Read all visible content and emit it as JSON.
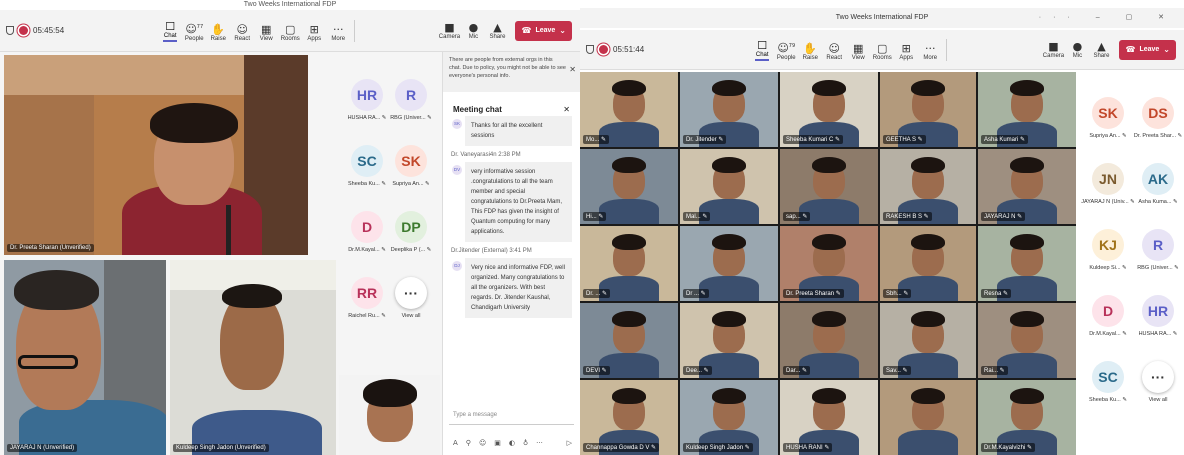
{
  "left": {
    "title": "Two Weeks International FDP",
    "timer": "05:45:54",
    "tools": [
      {
        "icon": "chat-icon",
        "glyph": "☐",
        "label": "Chat",
        "active": true
      },
      {
        "icon": "people-icon",
        "glyph": "☺",
        "label": "People",
        "badge": "77"
      },
      {
        "icon": "raise-hand-icon",
        "glyph": "✋",
        "label": "Raise"
      },
      {
        "icon": "react-icon",
        "glyph": "☺",
        "label": "React"
      },
      {
        "icon": "view-icon",
        "glyph": "▦",
        "label": "View"
      },
      {
        "icon": "rooms-icon",
        "glyph": "▢",
        "label": "Rooms"
      },
      {
        "icon": "apps-icon",
        "glyph": "⊞",
        "label": "Apps"
      },
      {
        "icon": "more-icon",
        "glyph": "···",
        "label": "More"
      }
    ],
    "devices": [
      {
        "icon": "camera-icon",
        "glyph": "■",
        "label": "Camera"
      },
      {
        "icon": "mic-icon",
        "glyph": "●",
        "label": "Mic"
      },
      {
        "icon": "share-icon",
        "glyph": "▲",
        "label": "Share"
      }
    ],
    "leave": "Leave",
    "speaker": "Dr. Preeta Sharan (Unverified)",
    "tiles": [
      {
        "name": "JAYARAJ N (Unverified)"
      },
      {
        "name": "Kuldeep Singh Jadon (Unverified)"
      }
    ],
    "avatars": [
      {
        "initials": "HR",
        "name": "HUSHA RA...",
        "bg": "#e8e4f5",
        "fg": "#5b5fc7"
      },
      {
        "initials": "R",
        "name": "RBG (Univer...",
        "bg": "#e8e4f5",
        "fg": "#5b5fc7"
      },
      {
        "initials": "SC",
        "name": "Sheeba Ku...",
        "bg": "#dfeef5",
        "fg": "#2a6a8a"
      },
      {
        "initials": "SK",
        "name": "Supriya An...",
        "bg": "#fde3dc",
        "fg": "#c2472a"
      },
      {
        "initials": "D",
        "name": "Dr.M.Kayal...",
        "bg": "#fde3ea",
        "fg": "#b8325a"
      },
      {
        "initials": "DP",
        "name": "Deeplika P (...",
        "bg": "#e2f0de",
        "fg": "#3d7a2e"
      },
      {
        "initials": "RR",
        "name": "Raichel Ru...",
        "bg": "#fde3ea",
        "fg": "#b8325a"
      },
      {
        "initials": "···",
        "name": "View all",
        "bg": "#ffffff",
        "fg": "#333"
      }
    ],
    "chat": {
      "banner": "There are people from external orgs in this chat. Due to policy, you might not be able to see everyone's personal info.",
      "heading": "Meeting chat",
      "prev_text": "Thanks for all the excellent sessions",
      "messages": [
        {
          "author": "Dr. Vaneyarasi4n 2:38 PM",
          "initials": "DV",
          "text": "very informative session .congratulations to all the team member and special congratulations to Dr.Preeta Mam, This FDP has given the insight of Quantum computing for many applications."
        },
        {
          "author": "Dr.Jitender (External) 3:41 PM",
          "initials": "DJ",
          "text": "Very nice and informative FDP, well organized. Many congratulations to all the organizers. With best regards. Dr. Jitender Kaushal, Chandigarh University"
        }
      ],
      "placeholder": "Type a message"
    }
  },
  "right": {
    "title": "Two Weeks International FDP",
    "timer": "05:51:44",
    "people_badge": "79",
    "leave": "Leave",
    "grid": [
      [
        "Mo...",
        "Dr. Jitender",
        "Sheeba Kumari C",
        "GEETHA S",
        "Asha Kumari"
      ],
      [
        "Hi...",
        "Mal...",
        "sap...",
        "RAKESH B S",
        "JAYARAJ N"
      ],
      [
        "Dr. ...",
        "Dr ...",
        "Dr. Preeta Sharan",
        "Sbh...",
        "Resna"
      ],
      [
        "DEVI",
        "Dee...",
        "Dar...",
        "Sav...",
        "Rai..."
      ],
      [
        "Channappa Gowda D V",
        "Kuldeep Singh Jadon",
        "HUSHA RANI",
        "",
        "Dr.M.Kayalvizhi"
      ]
    ],
    "avatars": [
      {
        "initials": "SK",
        "name": "Supriya An...",
        "bg": "#fde3dc",
        "fg": "#c2472a"
      },
      {
        "initials": "DS",
        "name": "Dr. Preeta Shar...",
        "bg": "#fde3dc",
        "fg": "#c2472a"
      },
      {
        "initials": "JN",
        "name": "JAYARAJ N (Univ...",
        "bg": "#f3eadc",
        "fg": "#7a5a2e"
      },
      {
        "initials": "AK",
        "name": "Asha Kuma...",
        "bg": "#dfeef5",
        "fg": "#2a6a8a"
      },
      {
        "initials": "KJ",
        "name": "Kuldeep Si...",
        "bg": "#fdf0d9",
        "fg": "#a0731a"
      },
      {
        "initials": "R",
        "name": "RBG (Univer...",
        "bg": "#e8e4f5",
        "fg": "#5b5fc7"
      },
      {
        "initials": "D",
        "name": "Dr.M.Kayal...",
        "bg": "#fde3ea",
        "fg": "#b8325a"
      },
      {
        "initials": "HR",
        "name": "HUSHA RA...",
        "bg": "#e8e4f5",
        "fg": "#5b5fc7"
      },
      {
        "initials": "SC",
        "name": "Sheeba Ku...",
        "bg": "#dfeef5",
        "fg": "#2a6a8a"
      },
      {
        "initials": "···",
        "name": "View all",
        "bg": "#ffffff",
        "fg": "#333"
      }
    ]
  }
}
